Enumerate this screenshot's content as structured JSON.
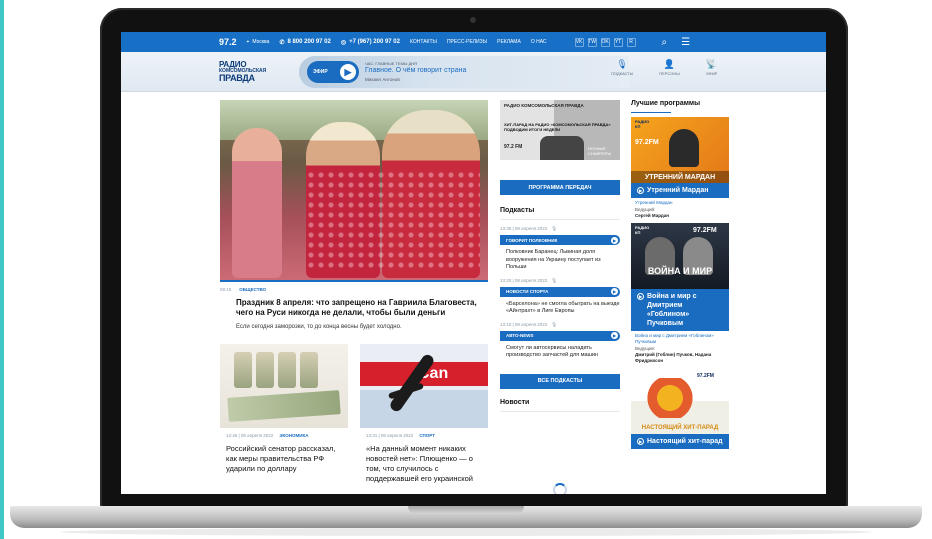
{
  "topbar": {
    "frequency": "97.2",
    "city": "Москва",
    "phone1": "8 800 200 97 02",
    "phone2": "+7 (967) 200 97 02",
    "nav": [
      "КОНТАКТЫ",
      "ПРЕСС-РЕЛИЗЫ",
      "РЕКЛАМА",
      "О НАС"
    ],
    "social": [
      "VK",
      "TW",
      "OK",
      "YT",
      "R"
    ]
  },
  "header": {
    "logo_line1": "РАДИО",
    "logo_line2": "КОМСОМОЛЬСКАЯ",
    "logo_line3": "ПРАВДА",
    "efir_label": "ЭФИР",
    "now_label": "ЧАС: ГЛАВНЫЕ ТЕМЫ ДНЯ",
    "now_title": "Главное. О чём говорит страна",
    "now_host": "Михаил Антонов",
    "icons": [
      {
        "label": "ПОДКАСТЫ",
        "icon": "mic-icon",
        "glyph": "🎙"
      },
      {
        "label": "ПЕРСОНЫ",
        "icon": "person-icon",
        "glyph": "👤"
      },
      {
        "label": "ЭФИР",
        "icon": "broadcast-icon",
        "glyph": "📡"
      }
    ]
  },
  "featured": {
    "time": "08:15",
    "category": "ОБЩЕСТВО",
    "title": "Праздник 8 апреля: что запрещено на Гавриила Благовеста, чего на Руси никогда не делали, чтобы были деньги",
    "lead": "Если сегодня заморозки, то до конца весны будет холодно."
  },
  "cards": [
    {
      "time": "13:46 | 08 апреля 2022",
      "category": "ЭКОНОМИКА",
      "title": "Российский сенатор рассказал, как меры правительства РФ ударили по доллару"
    },
    {
      "time": "13:31 | 08 апреля 2022",
      "category": "СПОРТ",
      "title": "«На данный момент никаких новостей нет»: Плющенко — о том, что случилось с поддержавшей его украинской"
    }
  ],
  "promo": {
    "logo": "РАДИО КОМСОМОЛЬСКАЯ ПРАВДА",
    "headline": "ХИТ-ПАРАД НА РАДИО «КОМСОМОЛЬСКАЯ ПРАВДА» ПОДВОДИМ ИТОГИ НЕДЕЛИ",
    "freq": "97.2 FM",
    "right_text": "НОЧНЫЕ СНАЙПЕРЫ"
  },
  "middle": {
    "schedule_button": "ПРОГРАММА ПЕРЕДАЧ",
    "podcasts_title": "Подкасты",
    "podcasts": [
      {
        "date": "13:35 | 08 апреля 2022",
        "show": "ГОВОРИТ ПОЛКОВНИК",
        "text": "Полковник Баранец: Львиная доля вооружения на Украину поступает из Польши"
      },
      {
        "date": "13:20 | 08 апреля 2022",
        "show": "НОВОСТИ СПОРТА",
        "text": "«Барселона» не смогла обыграть на выезде «Айнтрахт» в Лиге Европы"
      },
      {
        "date": "13:10 | 08 апреля 2022",
        "show": "АВТО-NEWS",
        "text": "Смогут ли автосервисы наладить производство запчастей для машин"
      }
    ],
    "all_podcasts_button": "ВСЕ ПОДКАСТЫ",
    "news_title": "Новости"
  },
  "right": {
    "title": "Лучшие программы",
    "programs": [
      {
        "banner": "УТРЕННИЙ МАРДАН",
        "fm": "97.2FM",
        "caption": "Утренний Мардан",
        "sub": "Утренний Мардан",
        "host_label": "Ведущий:",
        "hosts": "Сергей Мардан"
      },
      {
        "banner": "ВОЙНА И МИР",
        "fm": "97.2FM",
        "caption": "Война и мир с Дмитрием «Гоблином» Пучковым",
        "sub": "Война и мир с Дмитрием «Гоблином» Пучковым",
        "host_label": "Ведущие:",
        "hosts": "Дмитрий (Гоблин) Пучков, Надана Фридрихсон"
      },
      {
        "banner": "НАСТОЯЩИЙ ХИТ-ПАРАД",
        "fm": "97.2FM",
        "caption": "Настоящий хит-парад"
      }
    ]
  },
  "colors": {
    "brand": "#1a6cc0",
    "accent": "#3fc7c7"
  }
}
